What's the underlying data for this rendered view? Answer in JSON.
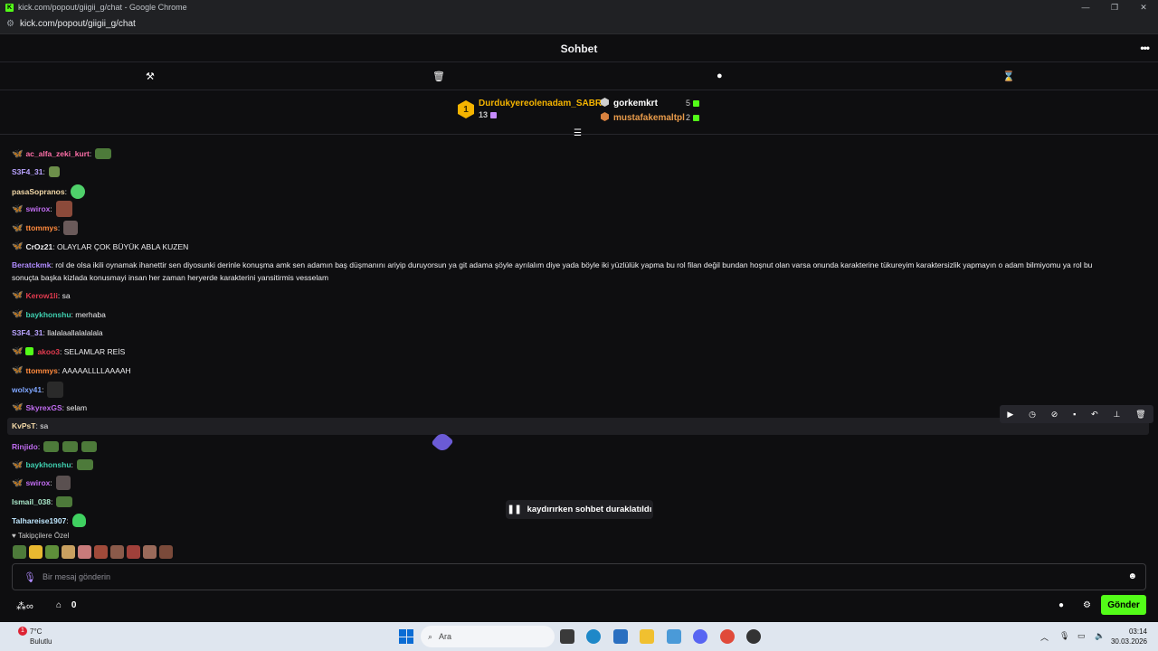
{
  "browser": {
    "window_title": "kick.com/popout/giigii_g/chat - Google Chrome",
    "url": "kick.com/popout/giigii_g/chat",
    "favicon": "K"
  },
  "header": {
    "title": "Sohbet"
  },
  "leaderboard": {
    "first": {
      "rank": "1",
      "name": "Durdukyereolenadam_SABRI",
      "count": "13"
    },
    "second": {
      "name": "gorkemkrt",
      "count": "5"
    },
    "third": {
      "name": "mustafakemaltpl",
      "count": "2"
    }
  },
  "messages": [
    {
      "user": "ac_alfa_zeki_kurt",
      "color": "#ff6fa8",
      "text": ""
    },
    {
      "user": "S3F4_31",
      "color": "#b9a3ff",
      "text": ""
    },
    {
      "user": "pasaSopranos",
      "color": "#f3d9a8",
      "text": ""
    },
    {
      "user": "swirox",
      "color": "#c06cf0",
      "text": ""
    },
    {
      "user": "ttommys",
      "color": "#ff8a3d",
      "text": ""
    },
    {
      "user": "CrOz21",
      "color": "#efeff1",
      "text": "OLAYLAR ÇOK BÜYÜK ABLA KUZEN"
    },
    {
      "user": "Beratckmk",
      "color": "#b18cff",
      "text": "rol de olsa ikili oynamak ihanettir sen diyosunki derinle konuşma amk sen adamın baş düşmanını ariyip duruyorsun ya git adama şöyle ayrılalım diye yada böyle iki yüzlülük yapma bu rol filan değil bundan hoşnut olan varsa onunda karakterine tükureyim karaktersizlik yapmayın o adam bilmiyomu ya rol bu sonuçta başka kizlada konusmayi insan her zaman heryerde karakterini yansitirmis vesselam"
    },
    {
      "user": "Kerow1li",
      "color": "#e23b4f",
      "text": "sa"
    },
    {
      "user": "baykhonshu",
      "color": "#3fd0b0",
      "text": "merhaba"
    },
    {
      "user": "S3F4_31",
      "color": "#b9a3ff",
      "text": "llalalaallalalalala"
    },
    {
      "user": "akoo3",
      "color": "#e23b4f",
      "text": "SELAMLAR REİS"
    },
    {
      "user": "ttommys",
      "color": "#ff8a3d",
      "text": "AAAAALLLLAAAAH"
    },
    {
      "user": "wolxy41",
      "color": "#7fa6ff",
      "text": ""
    },
    {
      "user": "SkyrexGS",
      "color": "#c06cf0",
      "text": "selam"
    },
    {
      "user": "KvPsT",
      "color": "#f3d9a8",
      "text": "sa"
    },
    {
      "user": "Rinjido",
      "color": "#c06cf0",
      "text": ""
    },
    {
      "user": "baykhonshu",
      "color": "#3fd0b0",
      "text": ""
    },
    {
      "user": "swirox",
      "color": "#c06cf0",
      "text": ""
    },
    {
      "user": "Ismail_038",
      "color": "#a8e6c8",
      "text": ""
    },
    {
      "user": "Talhareise1907",
      "color": "#bfe7ff",
      "text": ""
    }
  ],
  "paused_notice": "kaydırırken sohbet duraklatıldı",
  "followers_label": "Takipçilere Özel",
  "composer": {
    "placeholder": "Bir mesaj gönderin",
    "send_label": "Gönder",
    "store_count": "0"
  },
  "taskbar": {
    "weather_temp": "7°C",
    "weather_desc": "Bulutlu",
    "notification_count": "1",
    "search_placeholder": "Ara",
    "time": "03:14",
    "date": "30.03.2026"
  },
  "colors": {
    "accent": "#53fc18",
    "background": "#0e0e10"
  }
}
